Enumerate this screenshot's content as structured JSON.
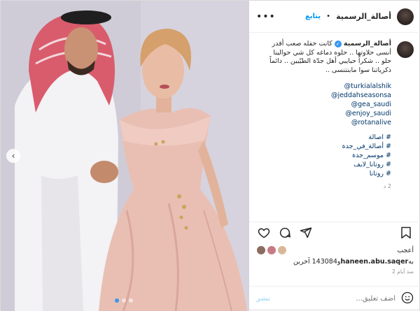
{
  "header": {
    "username": "أصالة_الرسمية",
    "follow_label": "يتابع",
    "separator": "•",
    "more_label": "•••"
  },
  "caption": {
    "username": "أصالة_الرسمية",
    "verified_mark": "✓",
    "lines": [
      "كانت حفله صعب أقدر",
      "أنسى حلاوتها .. حلوه دماغه كل شي حوالينا",
      "حلو .. شكراً حبايبي أهل جدّة الطيّبين .. دائماً",
      "ذكرياتنا سوا مابنتنسى .."
    ],
    "mentions": [
      "@turkialalshik",
      "@jeddahseasonsa",
      "@gea_saudi",
      "@enjoy_saudi",
      "@rotanalive"
    ],
    "hashtags": [
      "# اصالة",
      "# أصالة_في_جدة",
      "# موسم_جدة",
      "# روتانا_لايف",
      "# روتانا"
    ],
    "age": "2 د"
  },
  "likes": {
    "label": "أعجب",
    "text_prefix": "و143084 آخرين",
    "username": "haneen.abu.saqer",
    "suffix": "به"
  },
  "timestamp": "منذ أيام 2",
  "comment": {
    "placeholder": "أضف تعليق...",
    "post_label": "نشر"
  },
  "carousel": {
    "prev_glyph": "‹",
    "slides": 3,
    "active": 1
  },
  "colors": {
    "link": "#00376b",
    "follow": "#0095f6",
    "verified": "#3897f0",
    "post_disabled": "#b2dffc",
    "muted": "#8e8e8e"
  }
}
